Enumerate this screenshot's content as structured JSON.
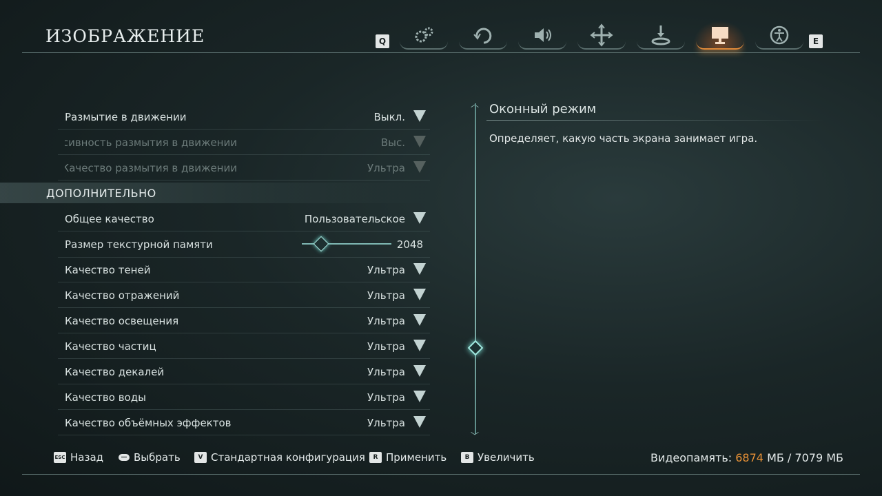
{
  "header": {
    "title": "ИЗОБРАЖЕНИЕ",
    "key_prev": "Q",
    "key_next": "E",
    "tabs": [
      {
        "icon": "gears-icon",
        "active": false
      },
      {
        "icon": "gamepad-rotate-icon",
        "active": false
      },
      {
        "icon": "speaker-icon",
        "active": false
      },
      {
        "icon": "move-arrows-icon",
        "active": false
      },
      {
        "icon": "download-icon",
        "active": false
      },
      {
        "icon": "monitor-icon",
        "active": true
      },
      {
        "icon": "accessibility-icon",
        "active": false
      }
    ]
  },
  "settings": {
    "rows_top": [
      {
        "label": "Размытие в движении",
        "value": "Выкл.",
        "dim": false
      },
      {
        "label": "Интенсивность размытия в движении",
        "value": "Выс.",
        "dim": true
      },
      {
        "label": "Качество размытия в движении",
        "value": "Ультра",
        "dim": true
      }
    ],
    "section": "ДОПОЛНИТЕЛЬНО",
    "overall": {
      "label": "Общее качество",
      "value": "Пользовательское"
    },
    "texture": {
      "label": "Размер текстурной памяти",
      "value": "2048"
    },
    "rows_bottom": [
      {
        "label": "Качество теней",
        "value": "Ультра"
      },
      {
        "label": "Качество отражений",
        "value": "Ультра"
      },
      {
        "label": "Качество освещения",
        "value": "Ультра"
      },
      {
        "label": "Качество частиц",
        "value": "Ультра"
      },
      {
        "label": "Качество декалей",
        "value": "Ультра"
      },
      {
        "label": "Качество воды",
        "value": "Ультра"
      },
      {
        "label": "Качество объёмных эффектов",
        "value": "Ультра"
      }
    ]
  },
  "description": {
    "title": "Оконный режим",
    "body": "Определяет, какую часть экрана занимает игра."
  },
  "footer": {
    "back": {
      "key": "ESC",
      "label": "Назад"
    },
    "select": {
      "key": "—",
      "label": "Выбрать"
    },
    "default": {
      "key": "V",
      "label": "Стандартная конфигурация"
    },
    "apply": {
      "key": "R",
      "label": "Применить"
    },
    "zoom": {
      "key": "B",
      "label": "Увеличить"
    },
    "vram_label": "Видеопамять:",
    "vram_used": "6874",
    "vram_rest": "МБ / 7079 МБ"
  },
  "colors": {
    "accent": "#e28b3a",
    "highlight": "#e99236",
    "teal": "#7ee5da"
  }
}
